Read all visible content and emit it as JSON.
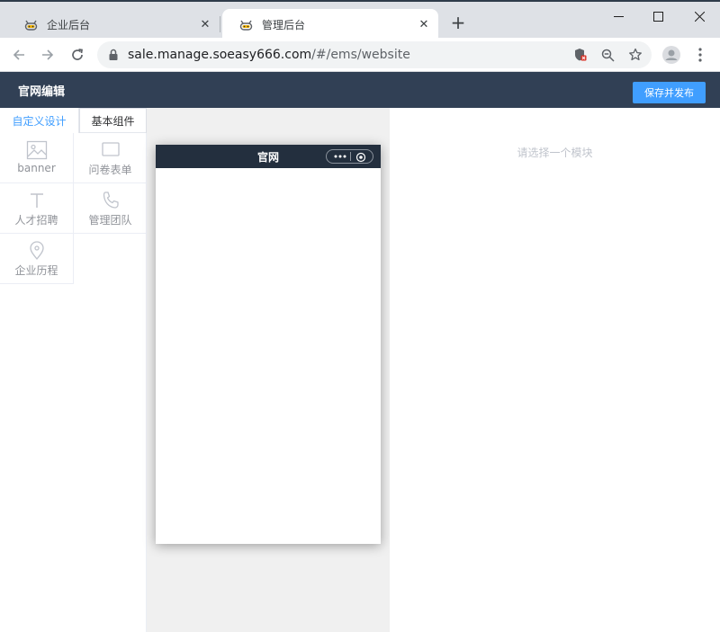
{
  "browser": {
    "tabs": [
      {
        "title": "企业后台",
        "active": false
      },
      {
        "title": "管理后台",
        "active": true
      }
    ],
    "url_host": "sale.manage.soeasy666.com",
    "url_path": "/#/ems/website"
  },
  "app": {
    "title": "官网编辑",
    "publish_label": "保存并发布",
    "accent_color": "#409eff",
    "header_color": "#314055"
  },
  "left_panel": {
    "tabs": [
      {
        "label": "自定义设计",
        "active": true
      },
      {
        "label": "基本组件",
        "active": false
      }
    ],
    "components": [
      {
        "label": "banner",
        "icon": "image-icon"
      },
      {
        "label": "问卷表单",
        "icon": "form-icon"
      },
      {
        "label": "人才招聘",
        "icon": "text-icon"
      },
      {
        "label": "管理团队",
        "icon": "phone-icon"
      },
      {
        "label": "企业历程",
        "icon": "location-icon"
      }
    ]
  },
  "preview": {
    "phone_title": "官网"
  },
  "right_panel": {
    "hint": "请选择一个模块"
  }
}
